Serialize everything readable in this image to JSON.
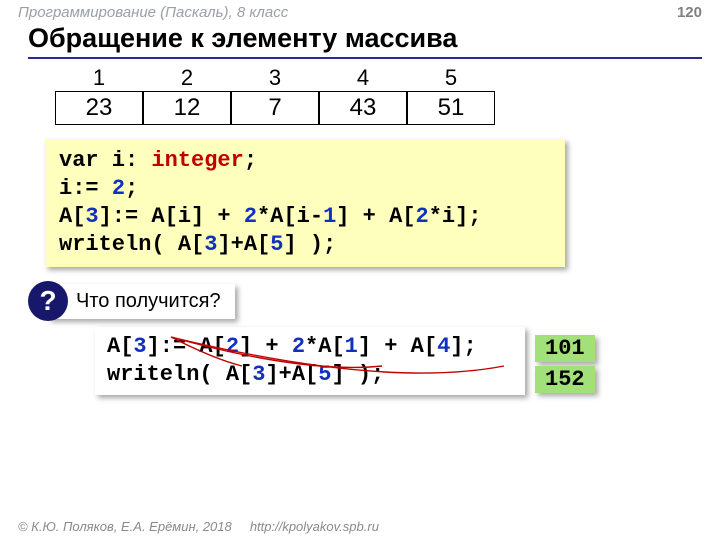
{
  "header": {
    "course": "Программирование (Паскаль), 8 класс",
    "page": "120"
  },
  "title": "Обращение к элементу массива",
  "array": {
    "idx": [
      "1",
      "2",
      "3",
      "4",
      "5"
    ],
    "vals": [
      "23",
      "12",
      "7",
      "43",
      "51"
    ]
  },
  "code1": {
    "t0a": "var i: ",
    "t0b": "integer",
    "t0c": ";",
    "t1a": "i:= ",
    "t1b": "2",
    "t1c": ";",
    "t2a": "A[",
    "t2b": "3",
    "t2c": "]:= A[i] + ",
    "t2d": "2",
    "t2e": "*A[i-",
    "t2f": "1",
    "t2g": "] + A[",
    "t2h": "2",
    "t2i": "*i];",
    "t3a": "writeln( A[",
    "t3b": "3",
    "t3c": "]+A[",
    "t3d": "5",
    "t3e": "] );"
  },
  "question": {
    "mark": "?",
    "text": "Что получится?"
  },
  "code2": {
    "t0a": "A[",
    "t0b": "3",
    "t0c": "]:= A[",
    "t0d": "2",
    "t0e": "] + ",
    "t0f": "2",
    "t0g": "*A[",
    "t0h": "1",
    "t0i": "] + A[",
    "t0j": "4",
    "t0k": "];",
    "t1a": "writeln( A[",
    "t1b": "3",
    "t1c": "]+A[",
    "t1d": "5",
    "t1e": "] );"
  },
  "results": [
    "101",
    "152"
  ],
  "footer": {
    "copyright": "© К.Ю. Поляков, Е.А. Ерёмин, 2018",
    "url": "http://kpolyakov.spb.ru"
  }
}
